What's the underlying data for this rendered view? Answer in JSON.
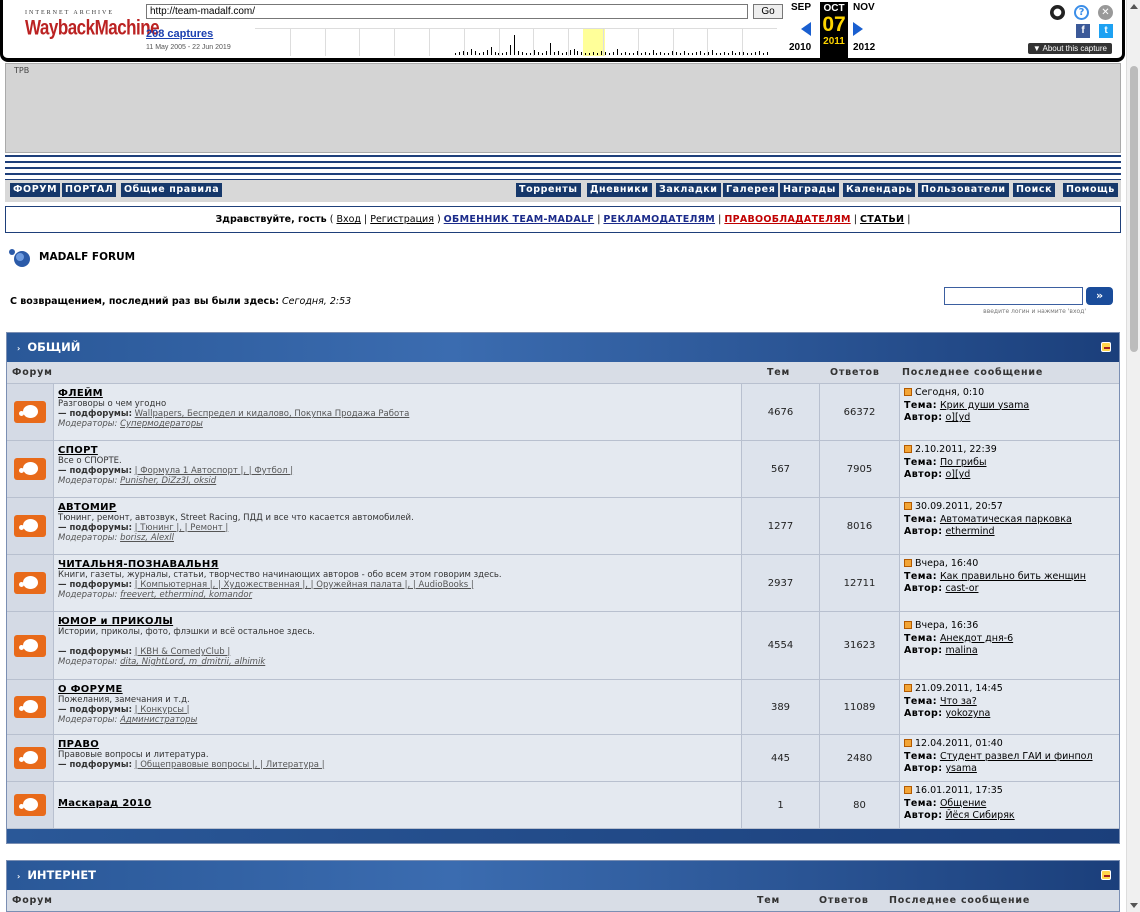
{
  "wayback": {
    "logo_top": "INTERNET ARCHIVE",
    "logo_main": "WaybackMachine",
    "url": "http://team-madalf.com/",
    "go_label": "Go",
    "captures": "208 captures",
    "range": "11 May 2005 - 22 Jun 2019",
    "prev_month": "SEP",
    "cur_month": "OCT",
    "cur_day": "07",
    "next_month": "NOV",
    "prev_year": "2010",
    "cur_year": "2011",
    "next_year": "2012",
    "about": "▼ About this capture",
    "user_icon": "user-icon",
    "help_icon": "help-icon",
    "close_icon": "close-icon",
    "facebook": "f",
    "twitter": "t",
    "spark_bars": [
      2,
      3,
      4,
      3,
      6,
      4,
      2,
      3,
      5,
      8,
      3,
      2,
      2,
      3,
      10,
      20,
      4,
      3,
      2,
      2,
      5,
      3,
      2,
      4,
      12,
      3,
      4,
      2,
      3,
      5,
      6,
      4,
      3,
      2,
      2,
      3,
      2,
      4,
      3,
      2,
      3,
      6,
      2,
      3,
      2,
      2,
      4,
      2,
      3,
      2,
      5,
      2,
      3,
      2,
      2,
      4,
      3,
      2,
      4,
      2,
      2,
      3,
      4,
      2,
      3,
      5,
      2,
      2,
      3,
      2,
      4,
      2,
      3,
      3,
      2,
      2,
      3,
      4,
      2,
      3
    ]
  },
  "banner_alt": "TPB",
  "nav_left": [
    "ФОРУМ",
    "ПОРТАЛ",
    "Общие правила"
  ],
  "nav_right": [
    "Торренты",
    "Дневники",
    "Закладки",
    "Галерея",
    "Награды",
    "Календарь",
    "Пользователи",
    "Поиск",
    "Помощь"
  ],
  "welcome": {
    "greeting": "Здравствуйте, гость",
    "login": "Вход",
    "register": "Регистрация",
    "exchange": "ОБМЕННИК TEAM-MADALF",
    "advertisers": "РЕКЛАМОДАТЕЛЯМ",
    "copyright": "ПРАВООБЛАДАТЕЛЯМ",
    "articles": "СТАТЬИ"
  },
  "forum_title": "MADALF FORUM",
  "return": {
    "label": "С возвращением, последний раз вы были здесь:",
    "value": "Сегодня, 2:53"
  },
  "login_hint": "введите логин и нажмите 'вход'",
  "login_go": "»",
  "categories": [
    {
      "title": "ОБЩИЙ",
      "col_forum": "Форум",
      "col_topics": "Тем",
      "col_replies": "Ответов",
      "col_last": "Последнее сообщение",
      "rows": [
        {
          "name": "ФЛЕЙМ",
          "desc": "Разговоры о чем угодно",
          "subs_label": "— подфорумы:",
          "subs": "Wallpapers, Беспредел и кидалово, Покупка Продажа Работа",
          "mods_label": "Модераторы:",
          "mods": "Супермодераторы",
          "topics": "4676",
          "replies": "66372",
          "last_date": "Сегодня, 0:10",
          "topic_label": "Тема:",
          "topic": "Крик души ysama",
          "author_label": "Автор:",
          "author": "o][yd"
        },
        {
          "name": "СПОРТ",
          "desc": "Все о СПОРТЕ.",
          "subs_label": "— подфорумы:",
          "subs": "| Формула 1 Автоспорт |, | Футбол |",
          "mods_label": "Модераторы:",
          "mods": "Punisher, DiZz3l, oksid",
          "topics": "567",
          "replies": "7905",
          "last_date": "2.10.2011, 22:39",
          "topic_label": "Тема:",
          "topic": "По грибы",
          "author_label": "Автор:",
          "author": "o][yd"
        },
        {
          "name": "АВТОМИР",
          "desc": "Тюнинг, ремонт, автозвук, Street Racing, ПДД и все что касается автомобилей.",
          "subs_label": "— подфорумы:",
          "subs": "| Тюнинг |, | Ремонт |",
          "mods_label": "Модераторы:",
          "mods": "borisz, Alexll",
          "topics": "1277",
          "replies": "8016",
          "last_date": "30.09.2011, 20:57",
          "topic_label": "Тема:",
          "topic": "Автоматическая парковка",
          "author_label": "Автор:",
          "author": "ethermind"
        },
        {
          "name": "ЧИТАЛЬНЯ-ПОЗНАВАЛЬНЯ",
          "desc": "Книги, газеты, журналы, статьи, творчество начинающих авторов - обо всем этом говорим здесь.",
          "subs_label": "— подфорумы:",
          "subs": "| Компьютерная |, | Художественная |, | Оружейная палата |, | AudioBooks |",
          "mods_label": "Модераторы:",
          "mods": "freevert, ethermind, komandor",
          "topics": "2937",
          "replies": "12711",
          "last_date": "Вчера, 16:40",
          "topic_label": "Тема:",
          "topic": "Как правильно бить женщин",
          "author_label": "Автор:",
          "author": "cast-or"
        },
        {
          "name": "ЮМОР и ПРИКОЛЫ",
          "desc": "Истории, приколы, фото, флэшки и всё остальное здесь.",
          "subs_label": "— подфорумы:",
          "subs": "| КВН & ComedyClub |",
          "mods_label": "Модераторы:",
          "mods": "dita, NightLord, m_dmitrii, alhimik",
          "topics": "4554",
          "replies": "31623",
          "last_date": "Вчера, 16:36",
          "topic_label": "Тема:",
          "topic": "Анекдот дня-6",
          "author_label": "Автор:",
          "author": "malina"
        },
        {
          "name": "О ФОРУМЕ",
          "desc": "Пожелания, замечания и т.д.",
          "subs_label": "— подфорумы:",
          "subs": "| Конкурсы |",
          "mods_label": "Модераторы:",
          "mods": "Администраторы",
          "topics": "389",
          "replies": "11089",
          "last_date": "21.09.2011, 14:45",
          "topic_label": "Тема:",
          "topic": "Что за?",
          "author_label": "Автор:",
          "author": "yokozyna"
        },
        {
          "name": "ПРАВО",
          "desc": "Правовые вопросы и литература.",
          "subs_label": "— подфорумы:",
          "subs": "| Общеправовые вопросы |, | Литература |",
          "mods_label": "",
          "mods": "",
          "topics": "445",
          "replies": "2480",
          "last_date": "12.04.2011, 01:40",
          "topic_label": "Тема:",
          "topic": "Студент развел ГАИ и финпол",
          "author_label": "Автор:",
          "author": "ysama"
        },
        {
          "name": "Маскарад 2010",
          "desc": "",
          "subs_label": "",
          "subs": "",
          "mods_label": "",
          "mods": "",
          "topics": "1",
          "replies": "80",
          "last_date": "16.01.2011, 17:35",
          "topic_label": "Тема:",
          "topic": "Общение",
          "author_label": "Автор:",
          "author": "Йёся Сибиряк"
        }
      ]
    },
    {
      "title": "ИНТЕРНЕТ",
      "col_forum": "Форум",
      "col_topics": "Тем",
      "col_replies": "Ответов",
      "col_last": "Последнее сообщение",
      "rows": []
    }
  ]
}
